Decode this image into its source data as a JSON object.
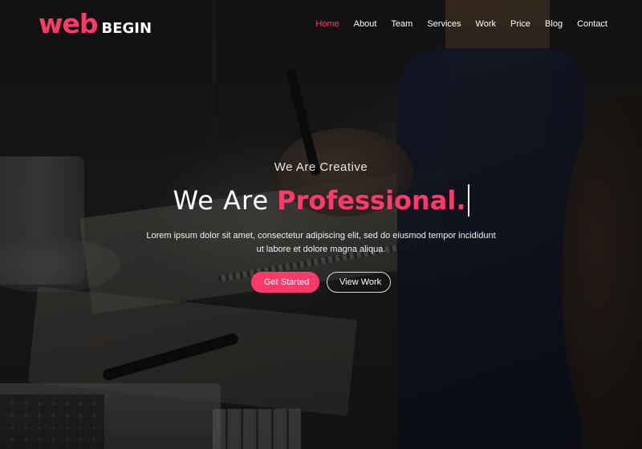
{
  "brand": {
    "logo_primary": "web",
    "logo_secondary": "BEGIN",
    "accent_color": "#ff3a6a"
  },
  "nav": {
    "items": [
      "Home",
      "About",
      "Team",
      "Services",
      "Work",
      "Price",
      "Blog",
      "Contact"
    ],
    "active": "Home"
  },
  "hero": {
    "kicker": "We Are Creative",
    "headline_light": "We Are",
    "headline_strong": "Professional.",
    "description": "Lorem ipsum dolor sit amet, consectetur adipiscing elit, sed do eiusmod tempor incididunt ut labore et dolore magna aliqua.",
    "primary_button": "Get Started",
    "secondary_button": "View Work"
  }
}
